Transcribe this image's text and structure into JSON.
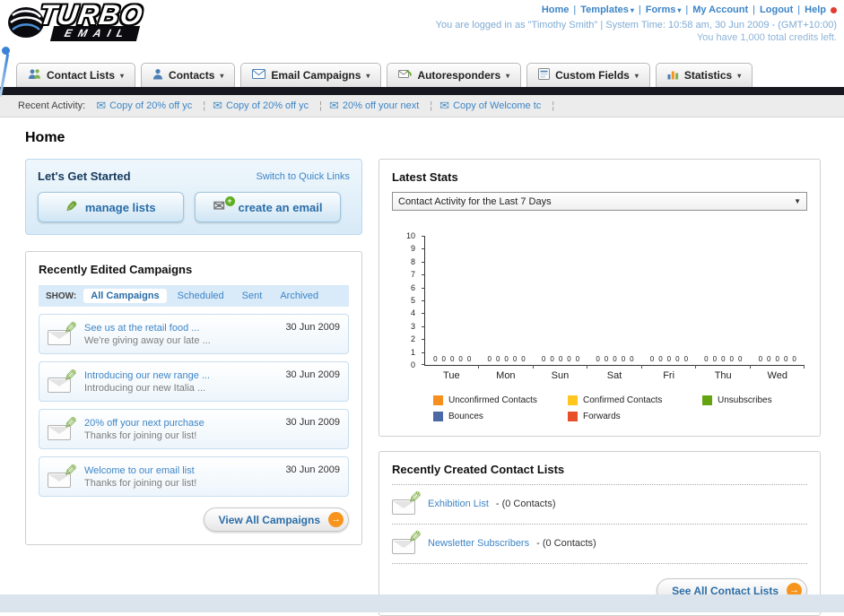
{
  "header": {
    "logo_top": "TURBO",
    "logo_bottom": "EMAIL",
    "top_links": [
      {
        "label": "Home",
        "has_dropdown": false
      },
      {
        "label": "Templates",
        "has_dropdown": true
      },
      {
        "label": "Forms",
        "has_dropdown": true
      },
      {
        "label": "My Account",
        "has_dropdown": false
      },
      {
        "label": "Logout",
        "has_dropdown": false
      },
      {
        "label": "Help",
        "has_dropdown": false
      }
    ],
    "login_info": "You are logged in as \"Timothy Smith\" | System Time: 10:58 am, 30 Jun 2009 - (GMT+10:00)",
    "credits_info": "You have 1,000 total credits left."
  },
  "nav": {
    "tabs": [
      {
        "label": "Contact Lists"
      },
      {
        "label": "Contacts"
      },
      {
        "label": "Email Campaigns"
      },
      {
        "label": "Autoresponders"
      },
      {
        "label": "Custom Fields"
      },
      {
        "label": "Statistics"
      }
    ]
  },
  "recent_activity": {
    "label": "Recent Activity:",
    "items": [
      {
        "label": "Copy of 20% off yc"
      },
      {
        "label": "Copy of 20% off yc"
      },
      {
        "label": "20% off your next"
      },
      {
        "label": "Copy of Welcome tc"
      }
    ]
  },
  "page_title": "Home",
  "get_started": {
    "title": "Let's Get Started",
    "switch_link": "Switch to Quick Links",
    "manage_lists_label": "manage lists",
    "create_email_label": "create an email"
  },
  "campaigns_panel": {
    "title": "Recently Edited Campaigns",
    "show_label": "SHOW:",
    "tabs": [
      {
        "label": "All Campaigns",
        "active": true
      },
      {
        "label": "Scheduled",
        "active": false
      },
      {
        "label": "Sent",
        "active": false
      },
      {
        "label": "Archived",
        "active": false
      }
    ],
    "items": [
      {
        "title": "See us at the retail food ...",
        "subtitle": "We're giving away our late ...",
        "date": "30 Jun 2009"
      },
      {
        "title": "Introducing our new range ...",
        "subtitle": "Introducing our new Italia ...",
        "date": "30 Jun 2009"
      },
      {
        "title": "20% off your next purchase",
        "subtitle": "Thanks for joining our list!",
        "date": "30 Jun 2009"
      },
      {
        "title": "Welcome to our email list",
        "subtitle": "Thanks for joining our list!",
        "date": "30 Jun 2009"
      }
    ],
    "view_all_label": "View All Campaigns"
  },
  "stats_panel": {
    "title": "Latest Stats",
    "dropdown_value": "Contact Activity for the Last 7 Days",
    "chart_data": {
      "type": "bar",
      "title": "Contact Activity for the Last 7 Days",
      "categories": [
        "Tue",
        "Mon",
        "Sun",
        "Sat",
        "Fri",
        "Thu",
        "Wed"
      ],
      "series": [
        {
          "name": "Unconfirmed Contacts",
          "color": "#F78E1E",
          "values": [
            0,
            0,
            0,
            0,
            0,
            0,
            0
          ]
        },
        {
          "name": "Confirmed Contacts",
          "color": "#FFC61E",
          "values": [
            0,
            0,
            0,
            0,
            0,
            0,
            0
          ]
        },
        {
          "name": "Unsubscribes",
          "color": "#64A312",
          "values": [
            0,
            0,
            0,
            0,
            0,
            0,
            0
          ]
        },
        {
          "name": "Bounces",
          "color": "#4A69A5",
          "values": [
            0,
            0,
            0,
            0,
            0,
            0,
            0
          ]
        },
        {
          "name": "Forwards",
          "color": "#E8502A",
          "values": [
            0,
            0,
            0,
            0,
            0,
            0,
            0
          ]
        }
      ],
      "ylim": [
        0,
        10
      ],
      "yticks": [
        0,
        1,
        2,
        3,
        4,
        5,
        6,
        7,
        8,
        9,
        10
      ],
      "xlabel": "",
      "ylabel": "",
      "grid": false,
      "legend_position": "bottom"
    }
  },
  "contact_lists_panel": {
    "title": "Recently Created Contact Lists",
    "items": [
      {
        "name": "Exhibition List",
        "suffix": "- (0 Contacts)"
      },
      {
        "name": "Newsletter Subscribers",
        "suffix": "- (0 Contacts)"
      }
    ],
    "see_all_label": "See All Contact Lists"
  },
  "icons": {
    "envelope": "✉",
    "pencil": "✎",
    "plus": "+",
    "arrow_right": "→",
    "dropdown_arrow": "▼",
    "tab_caret": "▾"
  },
  "colors": {
    "link_blue": "#3D85C6",
    "light_blue_text": "#7FABD4",
    "dark_bar": "#17171F",
    "orange_accent": "#F7941D"
  }
}
